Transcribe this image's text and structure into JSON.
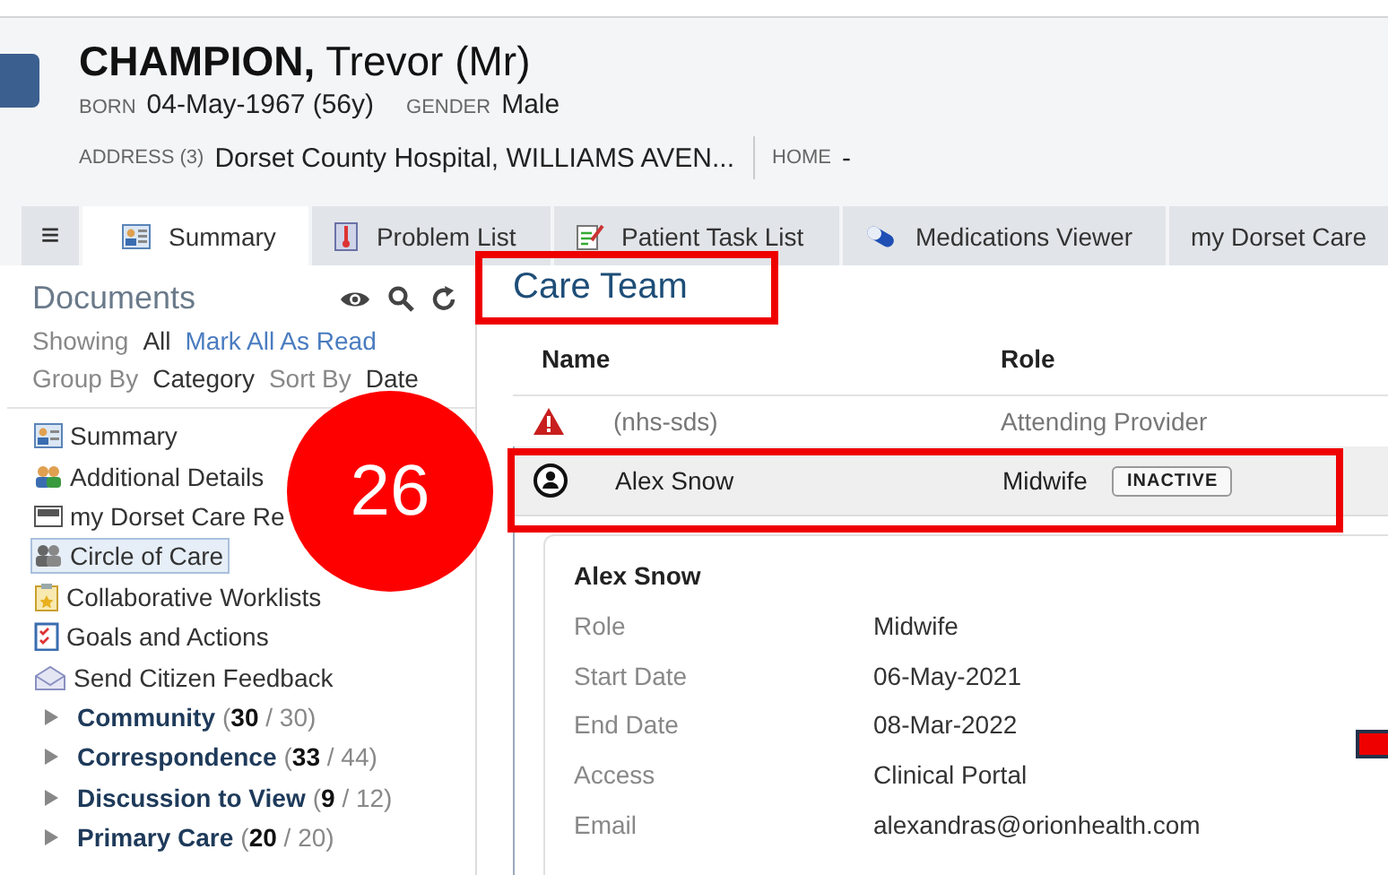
{
  "patient": {
    "surname": "CHAMPION,",
    "given": "Trevor (Mr)",
    "born_label": "BORN",
    "born": "04-May-1967 (56y)",
    "gender_label": "GENDER",
    "gender": "Male",
    "address_label": "ADDRESS (3)",
    "address": "Dorset County Hospital, WILLIAMS AVEN...",
    "home_label": "HOME",
    "home": "-"
  },
  "menu_button": "≡",
  "tabs": [
    {
      "label": "Summary",
      "selected": true
    },
    {
      "label": "Problem List",
      "selected": false
    },
    {
      "label": "Patient Task List",
      "selected": false
    },
    {
      "label": "Medications Viewer",
      "selected": false
    },
    {
      "label": "my Dorset Care",
      "selected": false
    }
  ],
  "documents": {
    "title": "Documents",
    "showing_label": "Showing",
    "showing": "All",
    "mark_all_read": "Mark All As Read",
    "group_by_label": "Group By",
    "group_by": "Category",
    "sort_by_label": "Sort By",
    "sort_by": "Date",
    "items": [
      {
        "label": "Summary",
        "selected": false
      },
      {
        "label": "Additional Details",
        "selected": false
      },
      {
        "label": "my Dorset Care Re",
        "selected": false
      },
      {
        "label": "Circle of Care",
        "selected": true
      },
      {
        "label": "Collaborative Worklists",
        "selected": false
      },
      {
        "label": "Goals and Actions",
        "selected": false
      },
      {
        "label": "Send Citizen Feedback",
        "selected": false
      }
    ],
    "categories": [
      {
        "label": "Community",
        "count": "(**30** / 30)",
        "expanded": false
      },
      {
        "label": "Correspondence",
        "count": "(**33** / 44)",
        "expanded": false
      },
      {
        "label": "Discussion to View",
        "count": "(**9** / 12)",
        "expanded": false
      },
      {
        "label": "Primary Care",
        "count": "(**20** / 20)",
        "expanded": false
      }
    ]
  },
  "care_team": {
    "title": "Care Team",
    "columns": [
      "Name",
      "Role"
    ],
    "rows": [
      {
        "kind": "warning",
        "name": "(nhs-sds)",
        "role": "Attending Provider",
        "selected": false
      },
      {
        "kind": "person",
        "name": "Alex Snow",
        "role": "Midwife",
        "status": "INACTIVE",
        "selected": true
      }
    ],
    "detail": {
      "name": "Alex Snow",
      "fields": [
        {
          "label": "Role",
          "value": "Midwife"
        },
        {
          "label": "Start Date",
          "value": "06-May-2021"
        },
        {
          "label": "End Date",
          "value": "08-Mar-2022"
        },
        {
          "label": "Access",
          "value": "Clinical Portal"
        },
        {
          "label": "Email",
          "value": "alexandras@orionhealth.com"
        }
      ]
    }
  },
  "step_badge": "26"
}
